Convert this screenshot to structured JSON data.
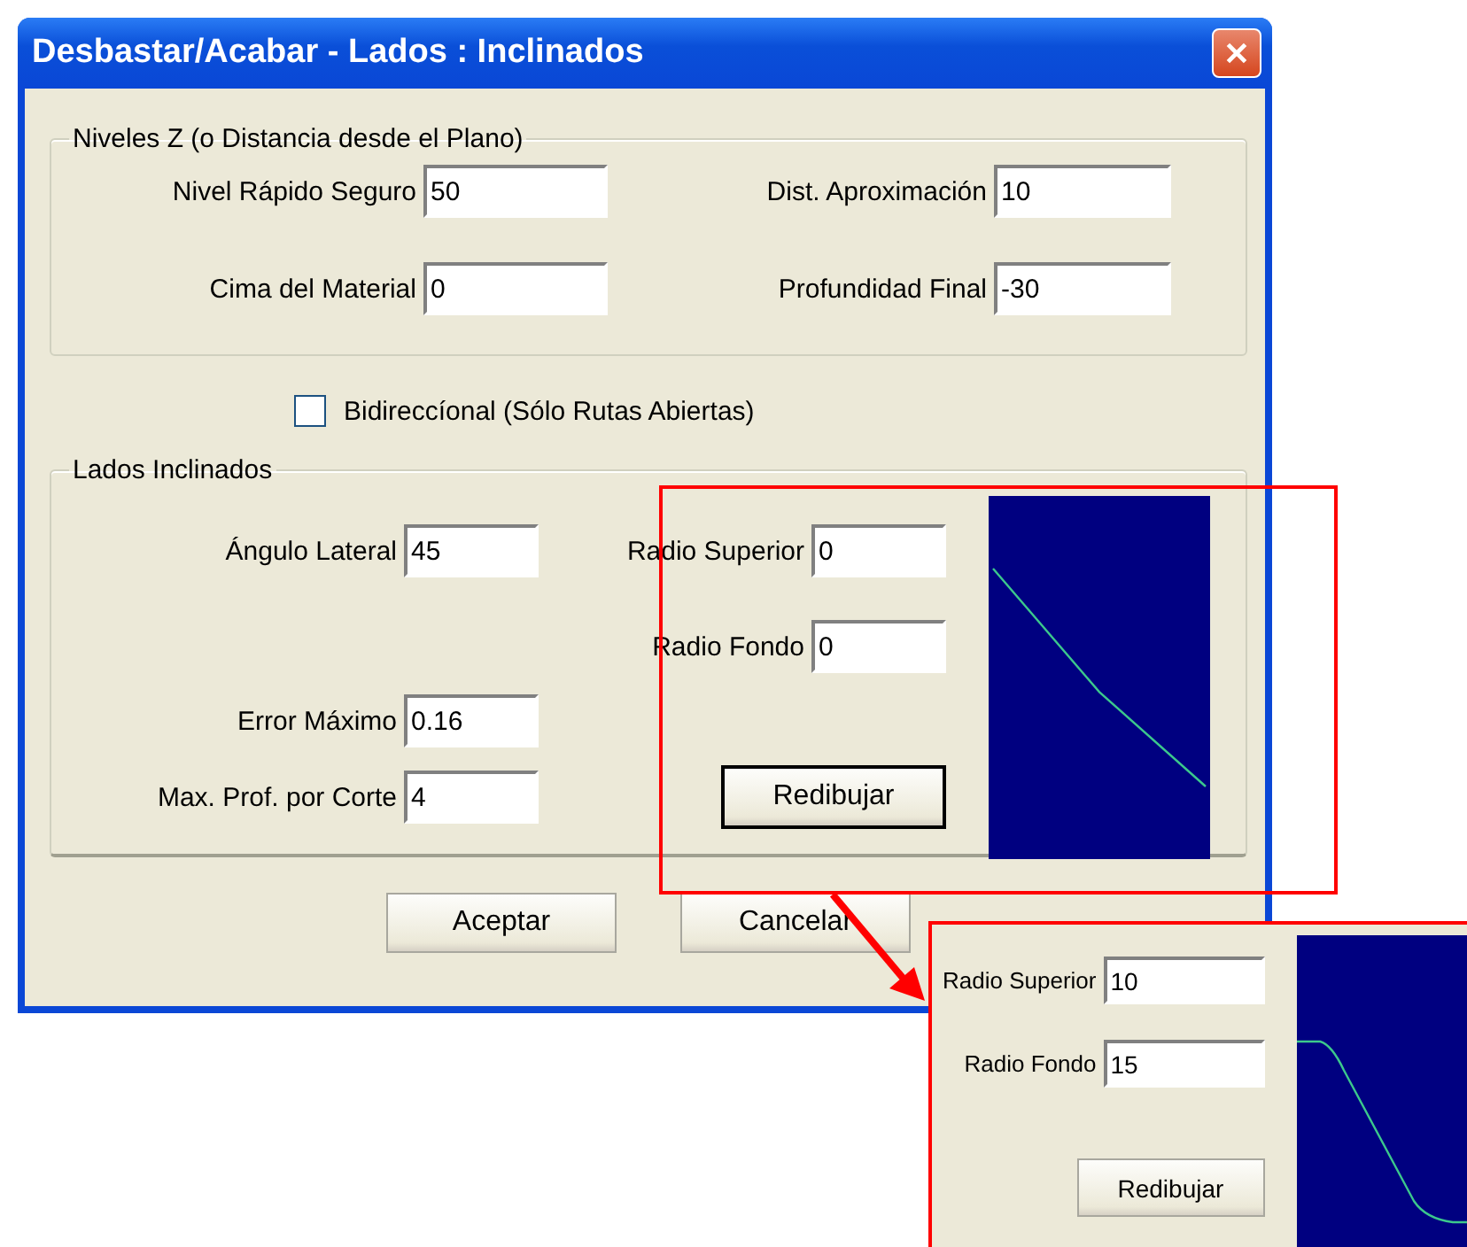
{
  "window": {
    "title": "Desbastar/Acabar - Lados : Inclinados"
  },
  "z_levels": {
    "title": "Niveles Z (o Distancia desde el Plano)",
    "fields": [
      {
        "label": "Nivel Rápido Seguro",
        "value": "50"
      },
      {
        "label": "Dist. Aproximación",
        "value": "10"
      },
      {
        "label": "Cima del Material",
        "value": "0"
      },
      {
        "label": "Profundidad Final",
        "value": "-30"
      }
    ]
  },
  "bidirectional": {
    "label": "Bidireccíonal (Sólo Rutas Abiertas)",
    "checked": false
  },
  "sloped_sides": {
    "title": "Lados Inclinados",
    "fields": [
      {
        "label": "Ángulo Lateral",
        "value": "45"
      },
      {
        "label": "Radio Superior",
        "value": "0"
      },
      {
        "label": "Radio Fondo",
        "value": "0"
      },
      {
        "label": "Error Máximo",
        "value": "0.16"
      },
      {
        "label": "Max. Prof. por Corte",
        "value": "4"
      }
    ],
    "redraw_button": "Redibujar"
  },
  "buttons": [
    "Aceptar",
    "Cancelar"
  ],
  "callout": {
    "fields": [
      {
        "label": "Radio Superior",
        "value": "10"
      },
      {
        "label": "Radio Fondo",
        "value": "15"
      }
    ],
    "redraw_button": "Redibujar"
  }
}
